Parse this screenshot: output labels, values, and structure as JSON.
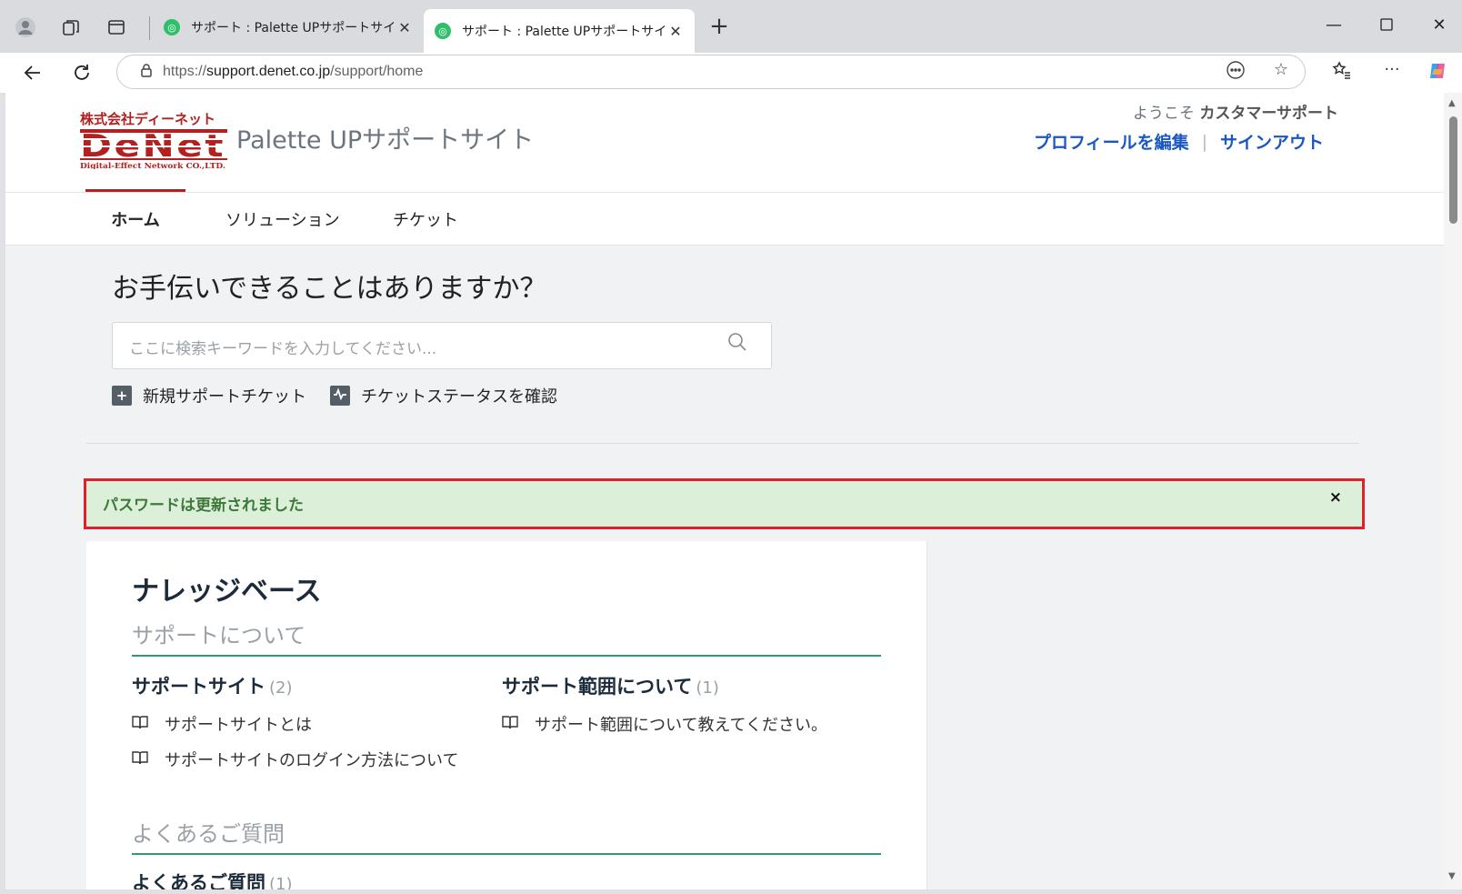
{
  "browser": {
    "tabs": [
      {
        "label": "サポート : Palette UPサポートサイト",
        "active": false
      },
      {
        "label": "サポート : Palette UPサポートサイト",
        "active": true
      }
    ],
    "url_prefix": "https://",
    "url_host": "support.denet.co.jp",
    "url_path": "/support/home"
  },
  "site": {
    "logo_company_text": "株式会社ディーネット",
    "logo_brand_text": "DeNet",
    "logo_tagline": "Digital-Effect Network CO.,LTD.",
    "title": "Palette UPサポートサイト",
    "welcome_prefix": "ようこそ",
    "welcome_user": "カスタマーサポート",
    "edit_profile": "プロフィールを編集",
    "sign_out": "サインアウト",
    "brand_color": "#b32020",
    "link_color": "#1a56c4"
  },
  "nav": {
    "items": [
      {
        "label": "ホーム",
        "active": true
      },
      {
        "label": "ソリューション",
        "active": false
      },
      {
        "label": "チケット",
        "active": false
      }
    ]
  },
  "hero": {
    "heading": "お手伝いできることはありますか？",
    "search_placeholder": "ここに検索キーワードを入力してください...",
    "new_ticket": "新規サポートチケット",
    "check_status": "チケットステータスを確認"
  },
  "alert": {
    "message": "パスワードは更新されました",
    "close": "×"
  },
  "kb": {
    "title": "ナレッジベース",
    "sections": [
      {
        "title": "サポートについて",
        "categories": [
          {
            "name": "サポートサイト",
            "count": "(2)",
            "articles": [
              "サポートサイトとは",
              "サポートサイトのログイン方法について"
            ]
          },
          {
            "name": "サポート範囲について",
            "count": "(1)",
            "articles": [
              "サポート範囲について教えてください。"
            ]
          }
        ]
      },
      {
        "title": "よくあるご質問",
        "categories": [
          {
            "name": "よくあるご質問",
            "count": "(1)",
            "articles": []
          }
        ]
      }
    ]
  }
}
